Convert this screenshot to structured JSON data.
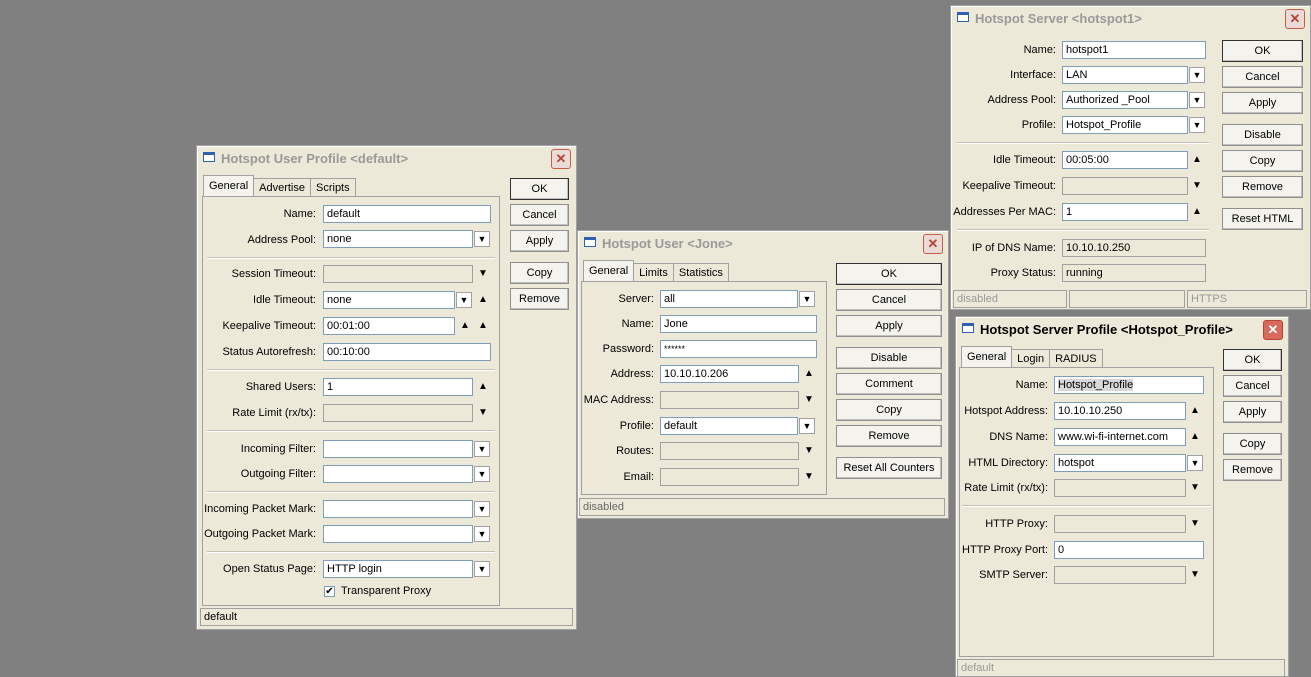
{
  "user_profile": {
    "title": "Hotspot User Profile <default>",
    "tabs": [
      "General",
      "Advertise",
      "Scripts"
    ],
    "labels": {
      "name": "Name:",
      "address_pool": "Address Pool:",
      "session_timeout": "Session Timeout:",
      "idle_timeout": "Idle Timeout:",
      "keepalive_timeout": "Keepalive Timeout:",
      "status_autorefresh": "Status Autorefresh:",
      "shared_users": "Shared Users:",
      "rate_limit": "Rate Limit (rx/tx):",
      "incoming_filter": "Incoming Filter:",
      "outgoing_filter": "Outgoing Filter:",
      "incoming_packet_mark": "Incoming Packet Mark:",
      "outgoing_packet_mark": "Outgoing Packet Mark:",
      "open_status_page": "Open Status Page:"
    },
    "values": {
      "name": "default",
      "address_pool": "none",
      "session_timeout": "",
      "idle_timeout": "none",
      "keepalive_timeout": "00:01:00",
      "status_autorefresh": "00:10:00",
      "shared_users": "1",
      "rate_limit": "",
      "incoming_filter": "",
      "outgoing_filter": "",
      "incoming_packet_mark": "",
      "outgoing_packet_mark": "",
      "open_status_page": "HTTP login"
    },
    "transparent_proxy": {
      "label": "Transparent Proxy",
      "checked": true,
      "mark": "✔"
    },
    "buttons": {
      "ok": "OK",
      "cancel": "Cancel",
      "apply": "Apply",
      "copy": "Copy",
      "remove": "Remove"
    },
    "status": "default"
  },
  "user": {
    "title": "Hotspot User <Jone>",
    "tabs": [
      "General",
      "Limits",
      "Statistics"
    ],
    "labels": {
      "server": "Server:",
      "name": "Name:",
      "password": "Password:",
      "address": "Address:",
      "mac_address": "MAC Address:",
      "profile": "Profile:",
      "routes": "Routes:",
      "email": "Email:"
    },
    "values": {
      "server": "all",
      "name": "Jone",
      "password": "******",
      "address": "10.10.10.206",
      "mac_address": "",
      "profile": "default",
      "routes": "",
      "email": ""
    },
    "buttons": {
      "ok": "OK",
      "cancel": "Cancel",
      "apply": "Apply",
      "disable": "Disable",
      "comment": "Comment",
      "copy": "Copy",
      "remove": "Remove",
      "reset": "Reset All Counters"
    },
    "status": "disabled"
  },
  "server": {
    "title": "Hotspot Server <hotspot1>",
    "labels": {
      "name": "Name:",
      "interface": "Interface:",
      "address_pool": "Address Pool:",
      "profile": "Profile:",
      "idle_timeout": "Idle Timeout:",
      "keepalive_timeout": "Keepalive Timeout:",
      "addresses_per_mac": "Addresses Per MAC:",
      "ip_of_dns_name": "IP of DNS Name:",
      "proxy_status": "Proxy Status:"
    },
    "values": {
      "name": "hotspot1",
      "interface": "LAN",
      "address_pool": "Authorized _Pool",
      "profile": "Hotspot_Profile",
      "idle_timeout": "00:05:00",
      "keepalive_timeout": "",
      "addresses_per_mac": "1",
      "ip_of_dns_name": "10.10.10.250",
      "proxy_status": "running"
    },
    "buttons": {
      "ok": "OK",
      "cancel": "Cancel",
      "apply": "Apply",
      "disable": "Disable",
      "copy": "Copy",
      "remove": "Remove",
      "reset_html": "Reset HTML"
    },
    "status": [
      "disabled",
      "",
      "HTTPS"
    ]
  },
  "server_profile": {
    "title": "Hotspot Server Profile <Hotspot_Profile>",
    "tabs": [
      "General",
      "Login",
      "RADIUS"
    ],
    "labels": {
      "name": "Name:",
      "hotspot_address": "Hotspot Address:",
      "dns_name": "DNS Name:",
      "html_directory": "HTML Directory:",
      "rate_limit": "Rate Limit (rx/tx):",
      "http_proxy": "HTTP Proxy:",
      "http_proxy_port": "HTTP Proxy Port:",
      "smtp_server": "SMTP Server:"
    },
    "values": {
      "name": "Hotspot_Profile",
      "hotspot_address": "10.10.10.250",
      "dns_name": "www.wi-fi-internet.com",
      "html_directory": "hotspot",
      "rate_limit": "",
      "http_proxy": "",
      "http_proxy_port": "0",
      "smtp_server": ""
    },
    "buttons": {
      "ok": "OK",
      "cancel": "Cancel",
      "apply": "Apply",
      "copy": "Copy",
      "remove": "Remove"
    },
    "status": "default"
  },
  "icons": {
    "close": "✕",
    "dropdown": "▼",
    "spin_up": "▲",
    "spin_down": "▼"
  }
}
